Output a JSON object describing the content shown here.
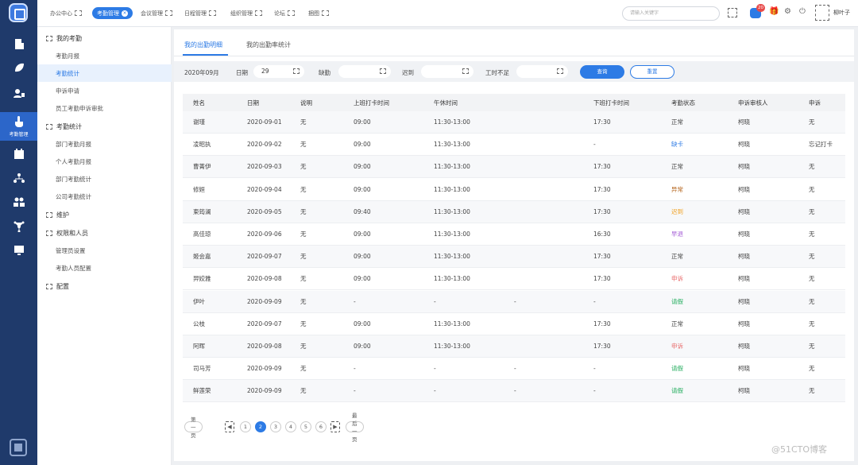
{
  "rail": {
    "items": [
      {
        "icon": "building-icon"
      },
      {
        "icon": "leaf-icon"
      },
      {
        "icon": "person-card-icon"
      },
      {
        "icon": "hand-pointer-icon",
        "label": "考勤管理"
      },
      {
        "icon": "calendar-icon"
      },
      {
        "icon": "org-tree-icon"
      },
      {
        "icon": "group-icon"
      },
      {
        "icon": "share-nodes-icon"
      },
      {
        "icon": "monitor-icon"
      }
    ]
  },
  "topbar": {
    "tabs": [
      "办公中心",
      "考勤管理",
      "会议管理",
      "日程管理",
      "组织管理",
      "论坛",
      "捆图"
    ],
    "active_tab_index": 1,
    "search_placeholder": "请输入关键字",
    "message_badge": "20",
    "username": "柳叶子"
  },
  "sidebar": {
    "items": [
      {
        "type": "group",
        "label": "我的考勤"
      },
      {
        "type": "sub",
        "label": "考勤月报"
      },
      {
        "type": "sub",
        "label": "考勤统计",
        "active": true
      },
      {
        "type": "sub",
        "label": "申诉申请"
      },
      {
        "type": "sub",
        "label": "员工考勤申诉审批"
      },
      {
        "type": "group",
        "label": "考勤统计"
      },
      {
        "type": "sub",
        "label": "部门考勤月报"
      },
      {
        "type": "sub",
        "label": "个人考勤月报"
      },
      {
        "type": "sub",
        "label": "部门考勤统计"
      },
      {
        "type": "sub",
        "label": "公司考勤统计"
      },
      {
        "type": "group",
        "label": "维护"
      },
      {
        "type": "group",
        "label": "权限和人员"
      },
      {
        "type": "sub",
        "label": "管理员设置"
      },
      {
        "type": "sub",
        "label": "考勤人员配置"
      },
      {
        "type": "group",
        "label": "配置"
      }
    ]
  },
  "main": {
    "tabs": [
      "我的出勤明细",
      "我的出勤率统计"
    ],
    "active_tab_index": 0,
    "filter": {
      "month": "2020年09月",
      "date_label": "日期",
      "date_value": "29",
      "absent_label": "缺勤",
      "late_label": "迟到",
      "short_hours_label": "工时不足",
      "query_button": "查询",
      "reset_button": "重置"
    },
    "table": {
      "columns": [
        "姓名",
        "日期",
        "说明",
        "上班打卡时间",
        "午休时间",
        "下班打卡时间",
        "考勤状态",
        "申诉审核人",
        "申诉"
      ],
      "rows": [
        {
          "name": "谢瑾",
          "date": "2020-09-01",
          "note": "无",
          "in": "09:00",
          "lunch": "11:30-13:00",
          "extra": "",
          "out": "17:30",
          "status": "正常",
          "status_color": "#444444",
          "reviewer": "柯晓",
          "appeal": "无"
        },
        {
          "name": "凌昭执",
          "date": "2020-09-02",
          "note": "无",
          "in": "09:00",
          "lunch": "11:30-13:00",
          "extra": "",
          "out": "-",
          "status": "缺卡",
          "status_color": "#2d7be5",
          "reviewer": "柯晓",
          "appeal": "忘记打卡"
        },
        {
          "name": "曹菁伊",
          "date": "2020-09-03",
          "note": "无",
          "in": "09:00",
          "lunch": "11:30-13:00",
          "extra": "",
          "out": "17:30",
          "status": "正常",
          "status_color": "#444444",
          "reviewer": "柯晓",
          "appeal": "无"
        },
        {
          "name": "修姮",
          "date": "2020-09-04",
          "note": "无",
          "in": "09:00",
          "lunch": "11:30-13:00",
          "extra": "",
          "out": "17:30",
          "status": "异常",
          "status_color": "#b5651d",
          "reviewer": "柯晓",
          "appeal": "无"
        },
        {
          "name": "柬筠澜",
          "date": "2020-09-05",
          "note": "无",
          "in": "09:40",
          "lunch": "11:30-13:00",
          "extra": "",
          "out": "17:30",
          "status": "迟到",
          "status_color": "#f0a020",
          "reviewer": "柯晓",
          "appeal": "无"
        },
        {
          "name": "高佳琼",
          "date": "2020-09-06",
          "note": "无",
          "in": "09:00",
          "lunch": "11:30-13:00",
          "extra": "",
          "out": "16:30",
          "status": "早退",
          "status_color": "#a35bd6",
          "reviewer": "柯晓",
          "appeal": "无"
        },
        {
          "name": "姬会嘉",
          "date": "2020-09-07",
          "note": "无",
          "in": "09:00",
          "lunch": "11:30-13:00",
          "extra": "",
          "out": "17:30",
          "status": "正常",
          "status_color": "#444444",
          "reviewer": "柯晓",
          "appeal": "无"
        },
        {
          "name": "羿姣雅",
          "date": "2020-09-08",
          "note": "无",
          "in": "09:00",
          "lunch": "11:30-13:00",
          "extra": "",
          "out": "17:30",
          "status": "申诉",
          "status_color": "#e86a6a",
          "reviewer": "柯晓",
          "appeal": "无"
        },
        {
          "name": "伊叶",
          "date": "2020-09-09",
          "note": "无",
          "in": "-",
          "lunch": "-",
          "extra": "-",
          "out": "-",
          "status": "请假",
          "status_color": "#27ae60",
          "reviewer": "柯晓",
          "appeal": "无"
        },
        {
          "name": "公枝",
          "date": "2020-09-07",
          "note": "无",
          "in": "09:00",
          "lunch": "11:30-13:00",
          "extra": "",
          "out": "17:30",
          "status": "正常",
          "status_color": "#444444",
          "reviewer": "柯晓",
          "appeal": "无"
        },
        {
          "name": "阿晖",
          "date": "2020-09-08",
          "note": "无",
          "in": "09:00",
          "lunch": "11:30-13:00",
          "extra": "",
          "out": "17:30",
          "status": "申诉",
          "status_color": "#e86a6a",
          "reviewer": "柯晓",
          "appeal": "无"
        },
        {
          "name": "司马芳",
          "date": "2020-09-09",
          "note": "无",
          "in": "-",
          "lunch": "-",
          "extra": "-",
          "out": "-",
          "status": "请假",
          "status_color": "#27ae60",
          "reviewer": "柯晓",
          "appeal": "无"
        },
        {
          "name": "鲜莲荣",
          "date": "2020-09-09",
          "note": "无",
          "in": "-",
          "lunch": "-",
          "extra": "-",
          "out": "-",
          "status": "请假",
          "status_color": "#27ae60",
          "reviewer": "柯晓",
          "appeal": "无"
        }
      ]
    },
    "pagination": {
      "first": "第一页",
      "pages": [
        "1",
        "2",
        "3",
        "4",
        "5",
        "6"
      ],
      "current": "2",
      "last": "最后一页"
    }
  },
  "watermark": "@51CTO博客"
}
